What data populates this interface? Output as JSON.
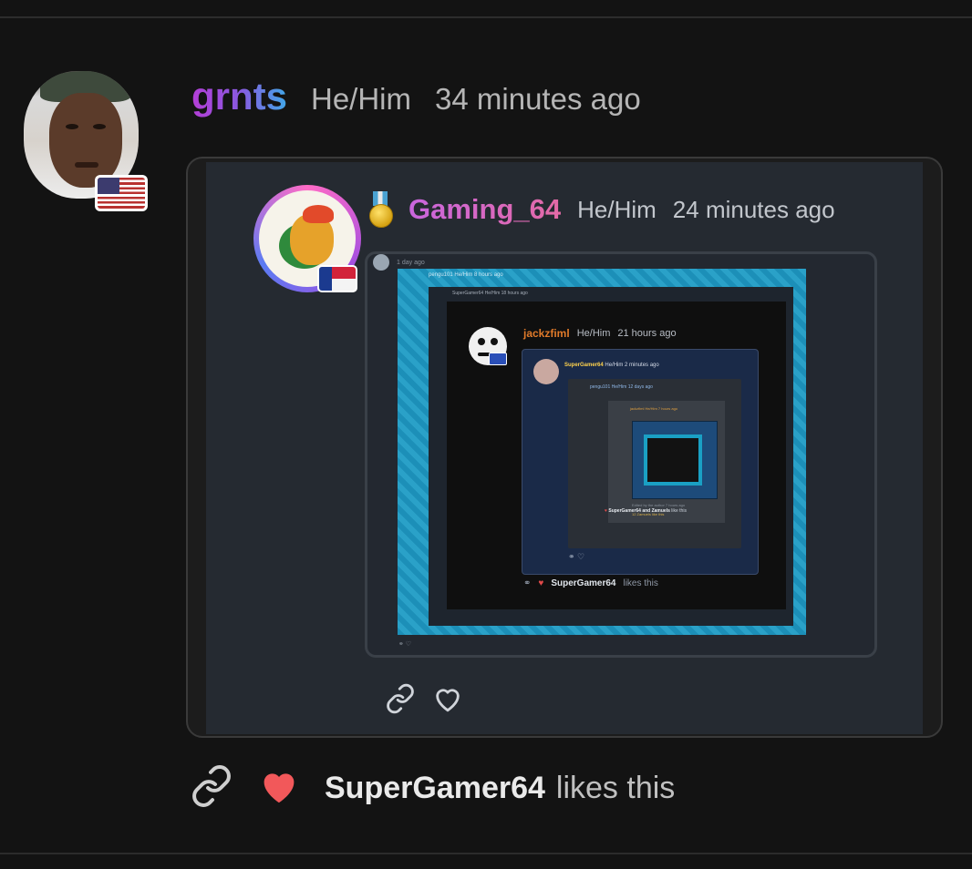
{
  "post": {
    "username": "grnts",
    "pronouns": "He/Him",
    "time": "34 minutes ago",
    "avatar_icon": "user-avatar-photo",
    "flag_icon": "us-flag-icon"
  },
  "reply": {
    "username": "Gaming_64",
    "pronouns": "He/Him",
    "time": "24 minutes ago",
    "badge_icon": "medal-icon",
    "flag_icon": "north-carolina-flag-icon",
    "nested": {
      "top_time": "1 day ago",
      "level1_name": "pengu101",
      "level1_meta": "He/Him 8 hours ago",
      "level2_name": "SuperGamer64",
      "level2_meta": "He/Him 18 hours ago",
      "jackz": {
        "name": "jackzfiml",
        "pronouns": "He/Him",
        "time": "21 hours ago"
      },
      "navy": {
        "name": "SuperGamer64",
        "meta": "He/Him 2 minutes ago",
        "gray_header": "pengu101 He/Him 12 days ago",
        "mid_header": "jackzfiml He/Him 7 hours ago",
        "mid_foot": "Edited by the author 7 hours ago",
        "mid_foot2": "12 Zamuels like this",
        "gray_likes_names": "SuperGamer64 and Zamuels",
        "gray_likes_text": "like this"
      },
      "jackz_likes_name": "SuperGamer64",
      "jackz_likes_text": "likes this"
    }
  },
  "footer": {
    "likes_name": "SuperGamer64",
    "likes_text": "likes this",
    "link_icon": "link-icon",
    "heart_icon": "heart-icon"
  },
  "colors": {
    "background": "#131313",
    "card": "#252a31",
    "heart": "#f2585a",
    "gaming_name": "#d96bc4"
  }
}
